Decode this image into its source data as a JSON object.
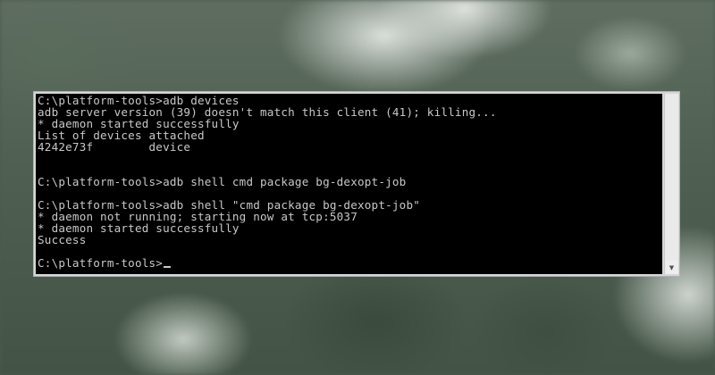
{
  "console": {
    "lines": [
      "C:\\platform-tools>adb devices",
      "adb server version (39) doesn't match this client (41); killing...",
      "* daemon started successfully",
      "List of devices attached",
      "4242e73f        device",
      "",
      "",
      "C:\\platform-tools>adb shell cmd package bg-dexopt-job",
      "",
      "C:\\platform-tools>adb shell \"cmd package bg-dexopt-job\"",
      "* daemon not running; starting now at tcp:5037",
      "* daemon started successfully",
      "Success",
      "",
      "C:\\platform-tools>"
    ]
  },
  "scrollbar": {
    "down_arrow_icon": "▼"
  },
  "colors": {
    "console_background": "#000000",
    "console_text": "#c8c8c8",
    "window_frame": "#d6d6d6"
  }
}
